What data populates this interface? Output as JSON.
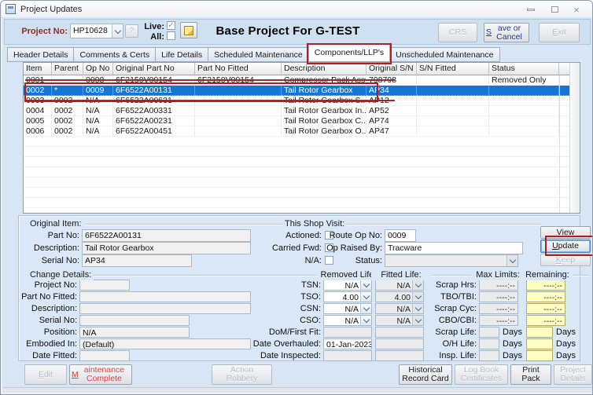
{
  "window": {
    "title": "Project Updates"
  },
  "icons": {
    "check": "✓",
    "close": "×",
    "help": "?"
  },
  "header": {
    "project_label": "Project No:",
    "project_value": "HP10628",
    "live_label": "Live:",
    "all_label": "All:",
    "banner": "Base Project For G-TEST",
    "crs": "CRS",
    "save_cancel": "Save or Cancel",
    "exit": "Exit"
  },
  "tabs": [
    "Header Details",
    "Comments & Certs",
    "Life Details",
    "Scheduled Maintenance",
    "Components/LLP's",
    "Unscheduled Maintenance"
  ],
  "table": {
    "columns": [
      "Item",
      "Parent",
      "Op No",
      "Original Part No",
      "Part No Fitted",
      "Description",
      "Original S/N",
      "S/N Fitted",
      "Status",
      ""
    ],
    "rows": [
      {
        "item": "0001",
        "parent": "",
        "op_no": "0008",
        "original_part_no": "6F2150V00154",
        "part_no_fitted": "6F2150V00154",
        "description": "Compressor Pack Assy",
        "original_sn": "798798",
        "sn_fitted": "",
        "status": "Removed Only"
      },
      {
        "item": "0002",
        "parent": "*",
        "op_no": "0009",
        "original_part_no": "6F6522A00131",
        "part_no_fitted": "",
        "description": "Tail Rotor Gearbox",
        "original_sn": "AP34",
        "sn_fitted": "",
        "status": ""
      },
      {
        "item": "0003",
        "parent": "0002",
        "op_no": "N/A",
        "original_part_no": "6F6522A00631",
        "part_no_fitted": "",
        "description": "Tail Rotor Gearbox S...",
        "original_sn": "AP12",
        "sn_fitted": "",
        "status": ""
      },
      {
        "item": "0004",
        "parent": "0002",
        "op_no": "N/A",
        "original_part_no": "6F6522A00331",
        "part_no_fitted": "",
        "description": "Tail Rotor Gearbox In...",
        "original_sn": "AP52",
        "sn_fitted": "",
        "status": ""
      },
      {
        "item": "0005",
        "parent": "0002",
        "op_no": "N/A",
        "original_part_no": "6F6522A00231",
        "part_no_fitted": "",
        "description": "Tail Rotor Gearbox C...",
        "original_sn": "AP74",
        "sn_fitted": "",
        "status": ""
      },
      {
        "item": "0006",
        "parent": "0002",
        "op_no": "N/A",
        "original_part_no": "6F6522A00451",
        "part_no_fitted": "",
        "description": "Tail Rotor Gearbox O...",
        "original_sn": "AP47",
        "sn_fitted": "",
        "status": ""
      }
    ]
  },
  "original_item": {
    "title": "Original Item:",
    "part_no_label": "Part No:",
    "part_no": "6F6522A00131",
    "description_label": "Description:",
    "description": "Tail Rotor Gearbox",
    "serial_label": "Serial No:",
    "serial": "AP34"
  },
  "shop_visit": {
    "title": "This Shop Visit:",
    "actioned_label": "Actioned:",
    "carried_label": "Carried Fwd:",
    "na_label": "N/A:",
    "route_label": "Route Op No:",
    "route_value": "0009",
    "raised_label": "Op Raised By:",
    "raised_value": "Tracware",
    "status_label": "Status:",
    "status_value": ""
  },
  "actions": {
    "view": "View",
    "update": "Update",
    "keep": "Keep"
  },
  "change_details": {
    "title": "Change Details:",
    "project_label": "Project No:",
    "project_value": "",
    "part_fitted_label": "Part No Fitted:",
    "part_fitted_value": "",
    "description_label": "Description:",
    "description_value": "",
    "serial_label": "Serial No:",
    "serial_value": "",
    "position_label": "Position:",
    "position_value": "N/A",
    "embodied_label": "Embodied In:",
    "embodied_value": "(Default)",
    "date_fitted_label": "Date Fitted:",
    "date_fitted_value": ""
  },
  "life": {
    "removed_header": "Removed Life:",
    "fitted_header": "Fitted Life:",
    "rows": {
      "tsn": {
        "label": "TSN:",
        "removed": "N/A",
        "fitted": "N/A"
      },
      "tso": {
        "label": "TSO:",
        "removed": "4.00",
        "fitted": "4.00"
      },
      "csn": {
        "label": "CSN:",
        "removed": "N/A",
        "fitted": "N/A"
      },
      "cso": {
        "label": "CSO:",
        "removed": "N/A",
        "fitted": "N/A"
      },
      "dom": {
        "label": "DoM/First Fit:",
        "removed": "",
        "fitted": ""
      },
      "overhauled": {
        "label": "Date Overhauled:",
        "removed": "01-Jan-2023",
        "fitted": ""
      },
      "inspected": {
        "label": "Date Inspected:",
        "removed": "",
        "fitted": ""
      }
    }
  },
  "limits": {
    "max_header": "Max Limits:",
    "remaining_header": "Remaining:",
    "placeholder": "----:--",
    "days_label": "Days",
    "scrap_hrs_label": "Scrap Hrs:",
    "tbo_label": "TBO/TBI:",
    "scrap_cyc_label": "Scrap Cyc:",
    "cbo_label": "CBO/CBI:",
    "scrap_life_label": "Scrap Life:",
    "oh_life_label": "O/H Life:",
    "insp_life_label": "Insp. Life:"
  },
  "footer": {
    "edit": "Edit",
    "maintenance": "Maintenance Complete",
    "robbery": "Action Robbery",
    "historical": "Historical Record Card",
    "logbook": "Log Book Certificates",
    "print": "Print Pack",
    "project": "Project Details"
  },
  "colors": {
    "selection": "#1575d6",
    "annotation": "#b51e1e",
    "strike": "#9b2020",
    "highlight": "#ffffc2"
  }
}
